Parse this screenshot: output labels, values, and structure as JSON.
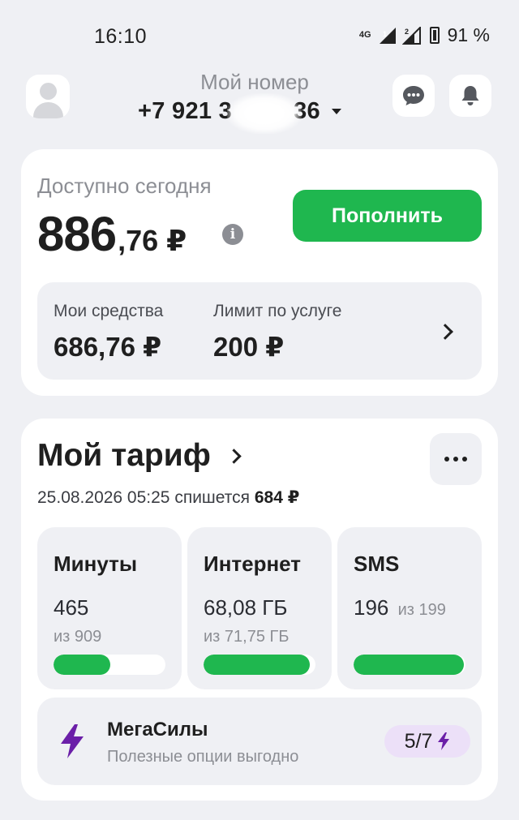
{
  "status_bar": {
    "time": "16:10",
    "network": "4G",
    "sim1": "1",
    "sim2": "2",
    "battery": "91 %"
  },
  "header": {
    "title": "Мой номер",
    "phone": "+7 921 3",
    "phone_end": "36"
  },
  "balance": {
    "label": "Доступно сегодня",
    "amount_main": "886",
    "amount_rest": ",76 ₽",
    "topup_label": "Пополнить",
    "funds_label": "Мои средства",
    "funds_value": "686,76 ₽",
    "limit_label": "Лимит по услуге",
    "limit_value": "200 ₽"
  },
  "tariff": {
    "title": "Мой тариф",
    "charge_prefix": "25.08.2026 05:25 спишется",
    "charge_amount": "684 ₽",
    "tiles": [
      {
        "title": "Минуты",
        "value": "465",
        "of": "из 909",
        "fill": 0.51
      },
      {
        "title": "Интернет",
        "value": "68,08 ГБ",
        "of": "из 71,75 ГБ",
        "fill": 0.95
      },
      {
        "title": "SMS",
        "value": "196",
        "of": "из 199",
        "fill": 0.985
      }
    ],
    "mega": {
      "title": "МегаСилы",
      "subtitle": "Полезные опции выгодно",
      "badge": "5/7"
    }
  },
  "colors": {
    "accent_green": "#1fb74f",
    "mega_purple": "#6b1fa8",
    "background": "#eff0f4"
  }
}
